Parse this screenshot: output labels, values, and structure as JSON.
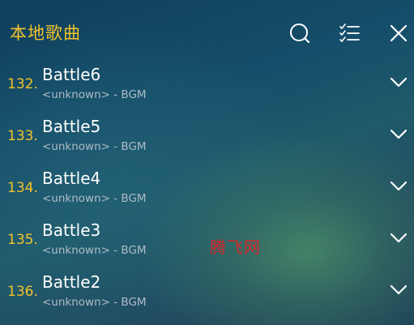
{
  "header": {
    "title": "本地歌曲",
    "icons": [
      "search-icon",
      "multi-select-icon",
      "close-icon"
    ]
  },
  "songs": [
    {
      "index": "132.",
      "title": "Battle6",
      "subtitle": "<unknown> - BGM"
    },
    {
      "index": "133.",
      "title": "Battle5",
      "subtitle": "<unknown> - BGM"
    },
    {
      "index": "134.",
      "title": "Battle4",
      "subtitle": "<unknown> - BGM"
    },
    {
      "index": "135.",
      "title": "Battle3",
      "subtitle": "<unknown> - BGM"
    },
    {
      "index": "136.",
      "title": "Battle2",
      "subtitle": "<unknown> - BGM"
    }
  ],
  "watermark": "腾飞网",
  "colors": {
    "accent": "#f4c22b",
    "text": "#ffffff",
    "subtext": "#aebbc6",
    "watermark": "#d8262a"
  }
}
